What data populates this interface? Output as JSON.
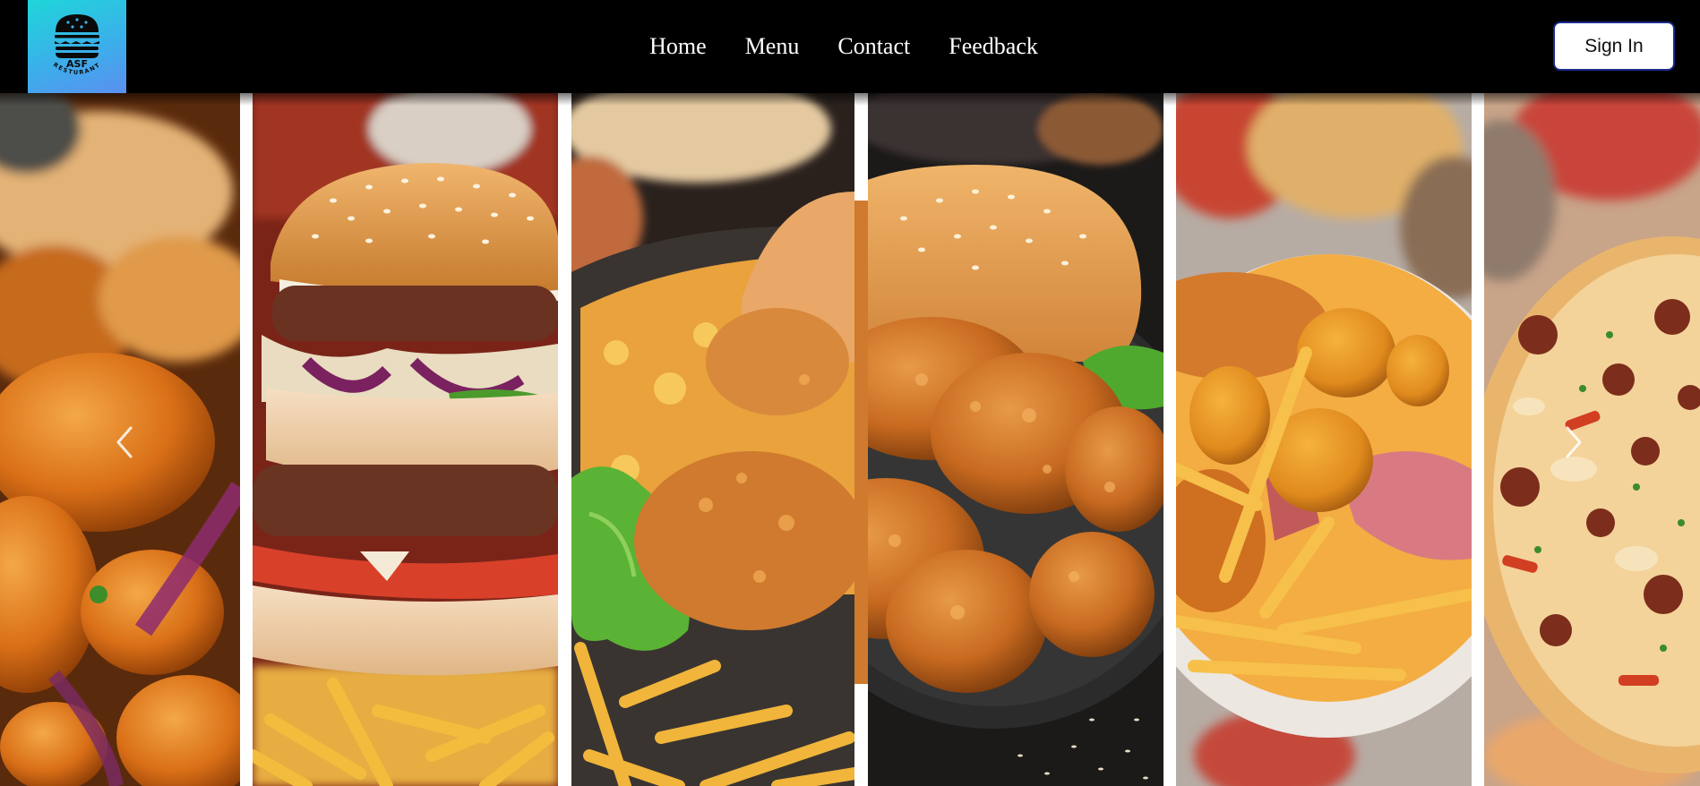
{
  "brand": {
    "logo_text": "ASF",
    "logo_subtext": "RESTURANT"
  },
  "nav": {
    "items": [
      {
        "label": "Home"
      },
      {
        "label": "Menu"
      },
      {
        "label": "Contact"
      },
      {
        "label": "Feedback"
      }
    ]
  },
  "header": {
    "sign_in_label": "Sign In"
  },
  "carousel": {
    "panels": [
      {
        "subject": "fried-chicken-bites"
      },
      {
        "subject": "double-burger"
      },
      {
        "subject": "fries-and-cheese"
      },
      {
        "subject": "fried-chicken-and-burger"
      },
      {
        "subject": "nuggets-and-fries"
      },
      {
        "subject": "pizza"
      }
    ],
    "prev_icon": "chevron-left-icon",
    "next_icon": "chevron-right-icon"
  },
  "colors": {
    "header_bg": "#000000",
    "logo_gradient_start": "#1fd6d9",
    "logo_gradient_end": "#5b8ff0",
    "sign_in_border": "#1a2a8c"
  }
}
